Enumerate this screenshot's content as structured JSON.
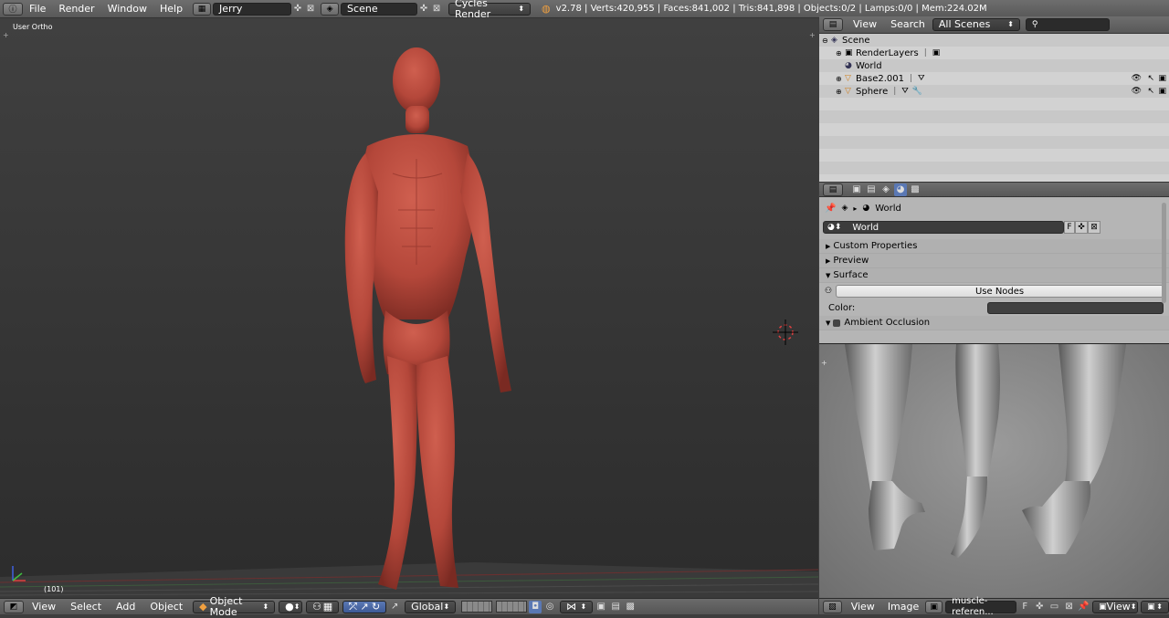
{
  "topbar": {
    "menus": [
      "File",
      "Render",
      "Window",
      "Help"
    ],
    "screen": "Jerry",
    "scene": "Scene",
    "engine": "Cycles Render",
    "stats": "v2.78 | Verts:420,955 | Faces:841,002 | Tris:841,898 | Objects:0/2 | Lamps:0/0 | Mem:224.02M"
  },
  "viewport": {
    "view_label": "User Ortho",
    "frame_label": "(101)",
    "menus": [
      "View",
      "Select",
      "Add",
      "Object"
    ],
    "mode": "Object Mode",
    "orientation": "Global"
  },
  "outliner": {
    "menus": [
      "View",
      "Search"
    ],
    "display": "All Scenes",
    "items": [
      {
        "label": "Scene"
      },
      {
        "label": "RenderLayers"
      },
      {
        "label": "World"
      },
      {
        "label": "Base2.001"
      },
      {
        "label": "Sphere"
      }
    ]
  },
  "properties": {
    "breadcrumb": "World",
    "world_name": "World",
    "fake_user": "F",
    "panels": [
      "Custom Properties",
      "Preview",
      "Surface"
    ],
    "use_nodes": "Use Nodes",
    "color_label": "Color:",
    "ao_label": "Ambient Occlusion"
  },
  "image_editor": {
    "menus": [
      "View",
      "Image"
    ],
    "image_name": "muscle-referen...",
    "fake_user": "F",
    "view_menu": "View"
  },
  "colors": {
    "figure": "#b4473a",
    "header": "#616161",
    "outliner_bg": "#c8c8c8",
    "props_bg": "#b5b5b5"
  }
}
